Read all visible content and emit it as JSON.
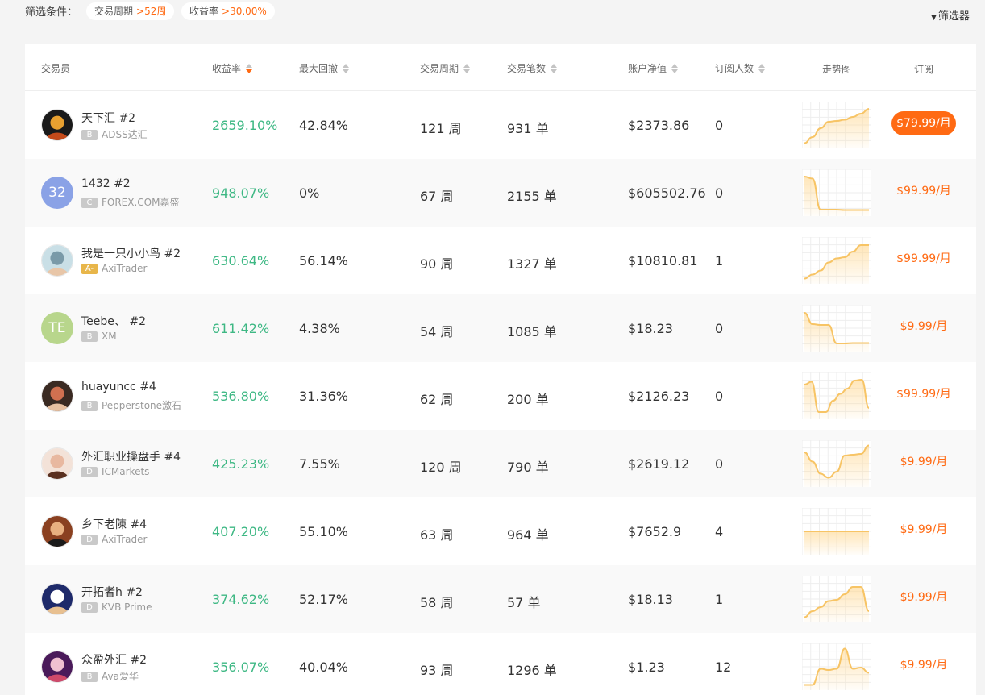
{
  "filters": {
    "label": "筛选条件：",
    "chips": [
      {
        "key": "交易周期",
        "value": ">52周"
      },
      {
        "key": "收益率",
        "value": ">30.00%"
      }
    ],
    "filter_button": "筛选器",
    "filter_icon": "funnel-icon"
  },
  "table": {
    "headers": {
      "trader": "交易员",
      "return": "收益率",
      "max_drawdown": "最大回撤",
      "period": "交易周期",
      "trades": "交易笔数",
      "equity": "账户净值",
      "subscribers": "订阅人数",
      "trend": "走势图",
      "subscribe": "订阅"
    },
    "active_sort": "return",
    "rows": [
      {
        "name": "天下汇 #2",
        "badge": "B",
        "broker": "ADSS达汇",
        "return": "2659.10%",
        "max_drawdown": "42.84%",
        "period": "121 周",
        "trades": "931 单",
        "equity": "$2373.86",
        "subscribers": "0",
        "price": "$79.99/月",
        "primary": true,
        "avatar": {
          "type": "photo",
          "colors": [
            "#1a1a1a",
            "#c44a1a",
            "#e8a030"
          ]
        },
        "trend": [
          0.05,
          0.2,
          0.42,
          0.58,
          0.6,
          0.63,
          0.7,
          0.78,
          0.9
        ]
      },
      {
        "name": "1432 #2",
        "badge": "C",
        "broker": "FOREX.COM嘉盛",
        "return": "948.07%",
        "max_drawdown": "0%",
        "period": "67 周",
        "trades": "2155 单",
        "equity": "$605502.76",
        "subscribers": "0",
        "price": "$99.99/月",
        "primary": false,
        "avatar": {
          "type": "initials",
          "text": "32",
          "color": "#8aa2e6"
        },
        "trend": [
          0.9,
          0.85,
          0.08,
          0.08,
          0.08,
          0.07,
          0.07,
          0.07,
          0.07
        ]
      },
      {
        "name": "我是一只小小鸟 #2",
        "badge": "A-",
        "badge_style": "gold",
        "broker": "AxiTrader",
        "return": "630.64%",
        "max_drawdown": "56.14%",
        "period": "90 周",
        "trades": "1327 单",
        "equity": "$10810.81",
        "subscribers": "1",
        "price": "$99.99/月",
        "primary": false,
        "avatar": {
          "type": "photo",
          "colors": [
            "#c9dfe6",
            "#e8c6a8",
            "#7a9aa8"
          ]
        },
        "trend": [
          0.05,
          0.15,
          0.25,
          0.45,
          0.55,
          0.58,
          0.72,
          0.88,
          0.88
        ]
      },
      {
        "name": "Teebe、 #2",
        "badge": "B",
        "broker": "XM",
        "return": "611.42%",
        "max_drawdown": "4.38%",
        "period": "54 周",
        "trades": "1085 单",
        "equity": "$18.23",
        "subscribers": "0",
        "price": "$9.99/月",
        "primary": false,
        "avatar": {
          "type": "initials",
          "text": "TE",
          "color": "#b8d68c"
        },
        "trend": [
          0.88,
          0.6,
          0.58,
          0.58,
          0.12,
          0.12,
          0.13,
          0.13,
          0.13
        ]
      },
      {
        "name": "huayuncc #4",
        "badge": "B",
        "broker": "Pepperstone激石",
        "return": "536.80%",
        "max_drawdown": "31.36%",
        "period": "62 周",
        "trades": "200 单",
        "equity": "$2126.23",
        "subscribers": "0",
        "price": "$99.99/月",
        "primary": false,
        "avatar": {
          "type": "photo",
          "colors": [
            "#3a2a22",
            "#e8c0a0",
            "#d07050"
          ]
        },
        "trend": [
          0.78,
          0.85,
          0.1,
          0.1,
          0.38,
          0.55,
          0.68,
          0.88,
          0.9,
          0.2
        ]
      },
      {
        "name": "外汇职业操盘手 #4",
        "badge": "D",
        "broker": "ICMarkets",
        "return": "425.23%",
        "max_drawdown": "7.55%",
        "period": "120 周",
        "trades": "790 单",
        "equity": "$2619.12",
        "subscribers": "0",
        "price": "$9.99/月",
        "primary": false,
        "avatar": {
          "type": "photo",
          "colors": [
            "#f3e2d8",
            "#5a3020",
            "#e8b8a0"
          ]
        },
        "trend": [
          0.78,
          0.55,
          0.25,
          0.15,
          0.3,
          0.7,
          0.72,
          0.74,
          0.95
        ]
      },
      {
        "name": "乡下老陳 #4",
        "badge": "D",
        "broker": "AxiTrader",
        "return": "407.20%",
        "max_drawdown": "55.10%",
        "period": "63 周",
        "trades": "964 单",
        "equity": "$7652.9",
        "subscribers": "4",
        "price": "$9.99/月",
        "primary": false,
        "avatar": {
          "type": "photo",
          "colors": [
            "#8a4020",
            "#1a1a1a",
            "#e8b080"
          ]
        },
        "trend": [
          0.5,
          0.5,
          0.5,
          0.5,
          0.5,
          0.5,
          0.5,
          0.5,
          0.5
        ]
      },
      {
        "name": "开拓者h #2",
        "badge": "D",
        "broker": "KVB Prime",
        "return": "374.62%",
        "max_drawdown": "52.17%",
        "period": "58 周",
        "trades": "57 单",
        "equity": "$18.13",
        "subscribers": "1",
        "price": "$9.99/月",
        "primary": false,
        "avatar": {
          "type": "photo",
          "colors": [
            "#1e2a6a",
            "#e8c090",
            "#ffffff"
          ]
        },
        "trend": [
          0.05,
          0.2,
          0.3,
          0.45,
          0.48,
          0.62,
          0.8,
          0.8,
          0.2
        ]
      },
      {
        "name": "众盈外汇 #2",
        "badge": "B",
        "broker": "Ava爱华",
        "return": "356.07%",
        "max_drawdown": "40.04%",
        "period": "93 周",
        "trades": "1296 单",
        "equity": "$1.23",
        "subscribers": "12",
        "price": "$9.99/月",
        "primary": false,
        "avatar": {
          "type": "photo",
          "colors": [
            "#4a1a5a",
            "#d04a6a",
            "#f0c0d0"
          ]
        },
        "trend": [
          0.05,
          0.05,
          0.45,
          0.42,
          0.45,
          0.95,
          0.45,
          0.48,
          0.35
        ]
      }
    ]
  }
}
